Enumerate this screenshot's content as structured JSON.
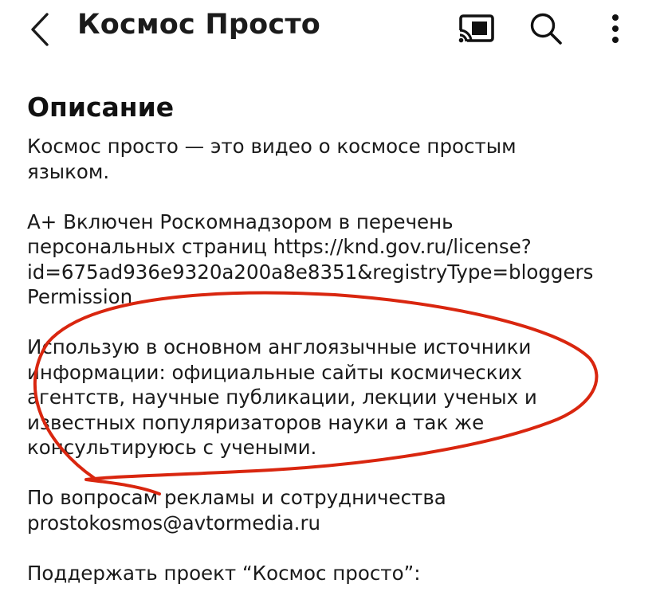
{
  "header": {
    "title": "Космос Просто",
    "back_icon": "chevron-left-icon",
    "cast_icon": "cast-icon",
    "search_icon": "search-icon",
    "more_icon": "more-vertical-icon"
  },
  "description": {
    "heading": "Описание",
    "paragraphs": [
      "Космос просто — это видео о космосе простым\nязыком.",
      "А+ Включен Роскомнадзором в перечень\nперсональных страниц https://knd.gov.ru/license?\nid=675ad936e9320a200a8e8351&registryType=bloggers\nPermission",
      "Использую в основном англоязычные источники\nинформации: официальные сайты космических\nагентств, научные публикации, лекции ученых и\nизвестных популяризаторов науки а так же\nконсультируюсь с учеными.",
      "По вопросам рекламы и сотрудничества\nprostokosmos@avtormedia.ru",
      "Поддержать проект “Космос просто”:"
    ]
  },
  "annotation": {
    "color": "#d9260f",
    "shape": "hand-drawn-ellipse"
  },
  "colors": {
    "text": "#1a1a1a",
    "background": "#ffffff"
  }
}
